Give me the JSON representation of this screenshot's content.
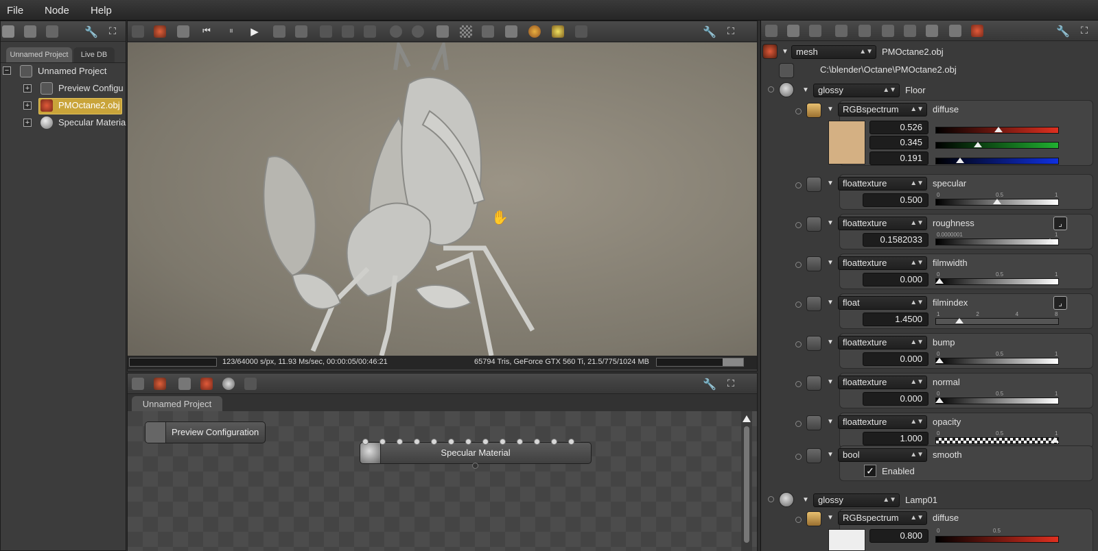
{
  "menu": [
    "File",
    "Node",
    "Help"
  ],
  "outliner": {
    "tabs": [
      "Unnamed Project",
      "Live DB"
    ],
    "tree": [
      {
        "label": "Unnamed Project",
        "icon": "project-icon"
      },
      {
        "label": "Preview Configu",
        "icon": "config-icon"
      },
      {
        "label": "PMOctane2.obj",
        "icon": "mesh-icon",
        "selected": true
      },
      {
        "label": "Specular Materia",
        "icon": "sphere-icon"
      }
    ]
  },
  "status": {
    "left": "123/64000 s/px, 11.93 Ms/sec, 00:00:05/00:46:21",
    "right": "65794 Tris, GeForce GTX 560 Ti, 21.5/775/1024 MB"
  },
  "graph": {
    "tab": "Unnamed Project",
    "nodes": {
      "preview": "Preview Configuration",
      "material": "Specular Material"
    }
  },
  "inspector": {
    "mesh": {
      "type": "mesh",
      "name": "PMOctane2.obj",
      "path": "C:\\blender\\Octane\\PMOctane2.obj"
    },
    "material1": {
      "type": "glossy",
      "name": "Floor"
    },
    "diffuse": {
      "type": "RGBspectrum",
      "label": "diffuse",
      "r": "0.526",
      "g": "0.345",
      "b": "0.191",
      "swatch": "#d4b083"
    },
    "params": [
      {
        "type": "floattexture",
        "label": "specular",
        "value": "0.500",
        "ticks": [
          "0",
          "0.5",
          "1"
        ],
        "pos": 0.5
      },
      {
        "type": "floattexture",
        "label": "roughness",
        "value": "0.1582033",
        "ticks": [
          "0.0000001",
          "",
          "1"
        ],
        "pos": 0.96
      },
      {
        "type": "floattexture",
        "label": "filmwidth",
        "value": "0.000",
        "ticks": [
          "0",
          "0.5",
          "1"
        ],
        "pos": 0.0
      },
      {
        "type": "float",
        "label": "filmindex",
        "value": "1.4500",
        "ticks": [
          "1",
          "2",
          "4",
          "8"
        ],
        "pos": 0.17
      },
      {
        "type": "floattexture",
        "label": "bump",
        "value": "0.000",
        "ticks": [
          "0",
          "0.5",
          "1"
        ],
        "pos": 0.0
      },
      {
        "type": "floattexture",
        "label": "normal",
        "value": "0.000",
        "ticks": [
          "0",
          "0.5",
          "1"
        ],
        "pos": 0.0
      },
      {
        "type": "floattexture",
        "label": "opacity",
        "value": "1.000",
        "ticks": [
          "0",
          "0.5",
          "1"
        ],
        "pos": 1.0
      }
    ],
    "smooth": {
      "type": "bool",
      "label": "smooth",
      "check_label": "Enabled"
    },
    "material2": {
      "type": "glossy",
      "name": "Lamp01"
    },
    "diffuse2": {
      "type": "RGBspectrum",
      "label": "diffuse",
      "value": "0.800",
      "ticks": [
        "0",
        "0.5"
      ]
    }
  }
}
